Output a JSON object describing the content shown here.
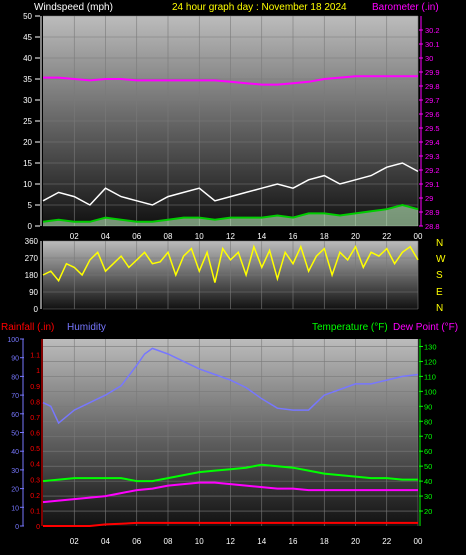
{
  "colors": {
    "background": "#000000",
    "axis_white": "#ffffff",
    "title_yellow": "#ffff00",
    "barometer": "#ff00ff",
    "wind_gust": "#ffffff",
    "wind_avg": "#00cc00",
    "wind_fill": "#c8ffc8",
    "direction": "#ffff00",
    "rain": "#ff0000",
    "humidity": "#7777ff",
    "temperature": "#00ff00",
    "dewpoint": "#ff00ff",
    "grid": "#7a7a7a"
  },
  "panel1": {
    "left_label": "Windspeed (mph)",
    "title": "24 hour graph day : November 18 2024",
    "right_label": "Barometer (.in)"
  },
  "panel2": {
    "compass": [
      "N",
      "W",
      "S",
      "E",
      "N"
    ]
  },
  "panel3": {
    "rain_label": "Rainfall (.in)",
    "humidity_label": "Humidity",
    "temp_label": "Temperature (°F)",
    "dew_label": "Dew Point (°F)"
  },
  "chart_data": [
    {
      "type": "line",
      "name": "wind-barometer",
      "x_ticks": [
        "02",
        "04",
        "06",
        "08",
        "10",
        "12",
        "14",
        "16",
        "18",
        "20",
        "22",
        "00"
      ],
      "x_range_hours": [
        0,
        24
      ],
      "y_left_range": [
        0,
        50
      ],
      "y_left_ticks": [
        "50",
        "45",
        "40",
        "35",
        "30",
        "25",
        "20",
        "15",
        "10",
        "5",
        "0"
      ],
      "y_right_range": [
        28.8,
        30.3
      ],
      "y_right_ticks": [
        "30.2",
        "30.1",
        "30",
        "29.9",
        "29.8",
        "29.7",
        "29.6",
        "29.5",
        "29.4",
        "29.3",
        "29.2",
        "29.1",
        "29",
        "28.9",
        "28.8"
      ],
      "series": [
        {
          "key": "barometer",
          "axis": "right",
          "x": [
            0,
            1,
            2,
            3,
            4,
            5,
            6,
            7,
            8,
            9,
            10,
            11,
            12,
            13,
            14,
            15,
            16,
            17,
            18,
            19,
            20,
            21,
            22,
            23,
            24
          ],
          "values": [
            29.86,
            29.86,
            29.85,
            29.84,
            29.85,
            29.85,
            29.84,
            29.84,
            29.84,
            29.84,
            29.84,
            29.84,
            29.83,
            29.82,
            29.81,
            29.81,
            29.82,
            29.83,
            29.85,
            29.86,
            29.87,
            29.87,
            29.87,
            29.87,
            29.87
          ]
        },
        {
          "key": "wind_gust",
          "axis": "left",
          "x": [
            0,
            1,
            2,
            3,
            4,
            5,
            6,
            7,
            8,
            9,
            10,
            11,
            12,
            13,
            14,
            15,
            16,
            17,
            18,
            19,
            20,
            21,
            22,
            23,
            24
          ],
          "values": [
            6,
            8,
            7,
            5,
            9,
            7,
            6,
            5,
            7,
            8,
            9,
            6,
            7,
            8,
            9,
            10,
            9,
            11,
            12,
            10,
            11,
            12,
            14,
            15,
            13
          ]
        },
        {
          "key": "wind_avg",
          "axis": "left",
          "x": [
            0,
            1,
            2,
            3,
            4,
            5,
            6,
            7,
            8,
            9,
            10,
            11,
            12,
            13,
            14,
            15,
            16,
            17,
            18,
            19,
            20,
            21,
            22,
            23,
            24
          ],
          "values": [
            1,
            1.5,
            1,
            1,
            2,
            1.5,
            1,
            1,
            1.5,
            2,
            2,
            1.5,
            2,
            2,
            2,
            2.5,
            2,
            3,
            3,
            2.5,
            3,
            3.5,
            4,
            5,
            4
          ]
        }
      ]
    },
    {
      "type": "line",
      "name": "wind-direction",
      "y_range": [
        0,
        360
      ],
      "y_ticks": [
        "360",
        "270",
        "180",
        "90",
        "0"
      ],
      "series": [
        {
          "key": "direction",
          "x": [
            0,
            0.5,
            1,
            1.5,
            2,
            2.5,
            3,
            3.5,
            4,
            4.5,
            5,
            5.5,
            6,
            6.5,
            7,
            7.5,
            8,
            8.5,
            9,
            9.5,
            10,
            10.5,
            11,
            11.5,
            12,
            12.5,
            13,
            13.5,
            14,
            14.5,
            15,
            15.5,
            16,
            16.5,
            17,
            17.5,
            18,
            18.5,
            19,
            19.5,
            20,
            20.5,
            21,
            21.5,
            22,
            22.5,
            23,
            23.5,
            24
          ],
          "values": [
            180,
            200,
            150,
            240,
            220,
            180,
            260,
            300,
            200,
            240,
            280,
            220,
            260,
            300,
            240,
            250,
            300,
            180,
            280,
            320,
            200,
            300,
            140,
            320,
            260,
            300,
            180,
            330,
            220,
            310,
            160,
            300,
            240,
            330,
            200,
            280,
            320,
            180,
            300,
            260,
            330,
            220,
            300,
            280,
            320,
            240,
            300,
            330,
            260
          ]
        }
      ]
    },
    {
      "type": "line",
      "name": "rain-humidity-temperature",
      "y_humidity_range": [
        0,
        100
      ],
      "y_humidity_ticks": [
        "100",
        "90",
        "80",
        "70",
        "60",
        "50",
        "40",
        "30",
        "20",
        "10",
        "0"
      ],
      "y_rain_range": [
        0,
        1.2
      ],
      "y_rain_ticks": [
        "1.1",
        "1",
        "0.9",
        "0.8",
        "0.7",
        "0.6",
        "0.5",
        "0.4",
        "0.3",
        "0.2",
        "0.1",
        "0"
      ],
      "y_temp_range": [
        10,
        135
      ],
      "y_temp_ticks": [
        "130",
        "120",
        "110",
        "100",
        "90",
        "80",
        "70",
        "60",
        "50",
        "40",
        "30",
        "20"
      ],
      "series": [
        {
          "key": "humidity",
          "axis": "humidity",
          "x": [
            0,
            0.5,
            1,
            2,
            3,
            4,
            5,
            6,
            6.5,
            7,
            8,
            9,
            10,
            11,
            12,
            13,
            14,
            15,
            16,
            17,
            17.5,
            18,
            19,
            20,
            21,
            22,
            23,
            24
          ],
          "values": [
            66,
            64,
            55,
            62,
            66,
            70,
            75,
            86,
            92,
            95,
            92,
            88,
            84,
            81,
            78,
            74,
            68,
            63,
            62,
            62,
            66,
            70,
            73,
            76,
            76,
            78,
            80,
            81
          ]
        },
        {
          "key": "temperature",
          "axis": "temp",
          "x": [
            0,
            1,
            2,
            3,
            4,
            5,
            6,
            7,
            8,
            9,
            10,
            11,
            12,
            13,
            14,
            15,
            16,
            17,
            18,
            19,
            20,
            21,
            22,
            23,
            24
          ],
          "values": [
            40,
            41,
            42,
            42,
            42,
            42,
            40,
            40,
            42,
            44,
            46,
            47,
            48,
            49,
            51,
            50,
            49,
            47,
            45,
            44,
            43,
            42,
            42,
            41,
            41
          ]
        },
        {
          "key": "dewpoint",
          "axis": "temp",
          "x": [
            0,
            1,
            2,
            3,
            4,
            5,
            6,
            7,
            8,
            9,
            10,
            11,
            12,
            13,
            14,
            15,
            16,
            17,
            18,
            19,
            20,
            21,
            22,
            23,
            24
          ],
          "values": [
            26,
            27,
            28,
            29,
            30,
            32,
            34,
            35,
            37,
            38,
            39,
            39,
            38,
            37,
            36,
            35,
            35,
            34,
            34,
            34,
            34,
            34,
            34,
            34,
            34
          ]
        },
        {
          "key": "rain",
          "axis": "rain",
          "x": [
            0,
            3,
            4,
            5,
            6,
            7,
            8,
            12,
            16,
            20,
            24
          ],
          "values": [
            0,
            0,
            0.01,
            0.015,
            0.02,
            0.02,
            0.02,
            0.02,
            0.02,
            0.02,
            0.02
          ]
        }
      ]
    }
  ]
}
